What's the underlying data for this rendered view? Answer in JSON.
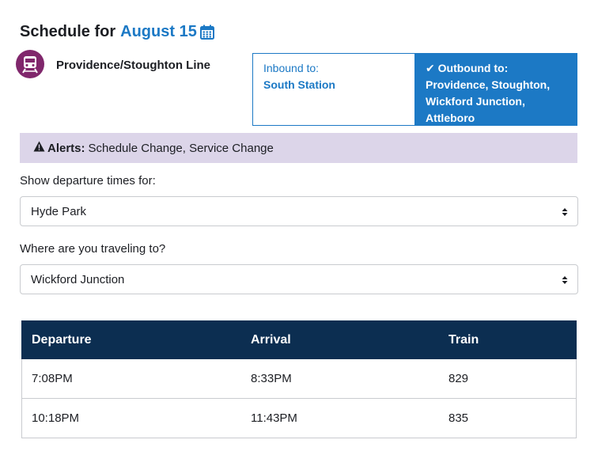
{
  "header": {
    "title_prefix": "Schedule for",
    "date": "August 15",
    "calendar_icon": "calendar-icon"
  },
  "route": {
    "name": "Providence/Stoughton Line",
    "icon": "commuter-rail-icon",
    "color": "#80276c"
  },
  "directions": {
    "inbound": {
      "label": "Inbound to:",
      "destination": "South Station",
      "selected": false
    },
    "outbound": {
      "check": "✔",
      "label": "Outbound to:",
      "destination": "Providence, Stoughton, Wickford Junction, Attleboro",
      "selected": true
    }
  },
  "alerts": {
    "icon": "warning-icon",
    "title": "Alerts:",
    "text": "Schedule Change, Service Change"
  },
  "origin": {
    "label": "Show departure times for:",
    "value": "Hyde Park"
  },
  "destination": {
    "label": "Where are you traveling to?",
    "value": "Wickford Junction"
  },
  "table": {
    "headers": [
      "Departure",
      "Arrival",
      "Train"
    ],
    "rows": [
      [
        "7:08PM",
        "8:33PM",
        "829"
      ],
      [
        "10:18PM",
        "11:43PM",
        "835"
      ]
    ]
  },
  "colors": {
    "accent": "#1c79c5",
    "table_header": "#0c2e51",
    "alert_bg": "#dcd5e9"
  }
}
